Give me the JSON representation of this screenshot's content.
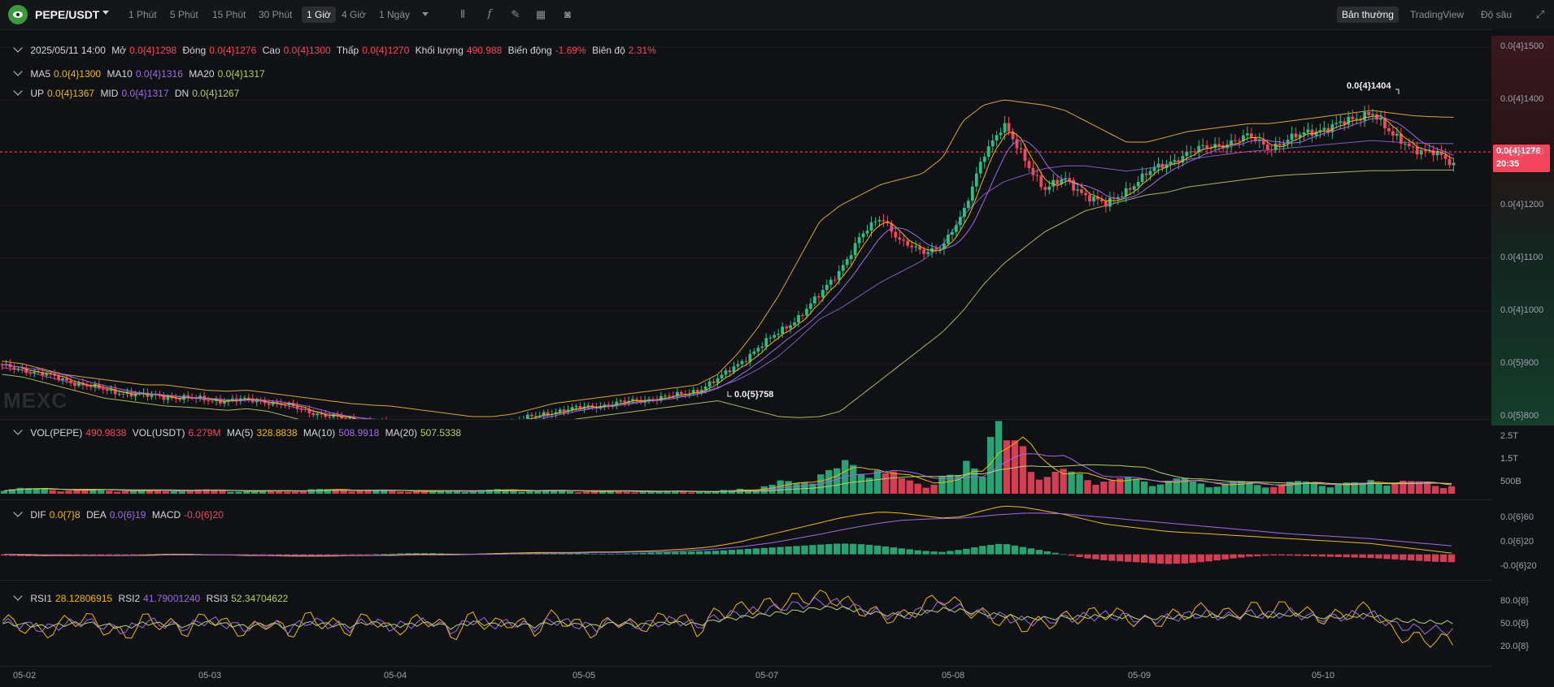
{
  "toolbar": {
    "symbol": "PEPE/USDT",
    "timeframes": [
      "1 Phút",
      "5 Phút",
      "15 Phút",
      "30 Phút",
      "1 Giờ",
      "4 Giờ",
      "1 Ngày"
    ],
    "active_timeframe": "1 Giờ",
    "modes": [
      "Bản thường",
      "TradingView",
      "Độ sâu"
    ],
    "active_mode": "Bản thường"
  },
  "ohlc": {
    "date": "2025/05/11 14:00",
    "open_label": "Mở",
    "open": "0.0{4}1298",
    "close_label": "Đóng",
    "close": "0.0{4}1276",
    "high_label": "Cao",
    "high": "0.0{4}1300",
    "low_label": "Thấp",
    "low": "0.0{4}1270",
    "volume_label": "Khối lượng",
    "volume": "490.988",
    "change_label": "Biến động",
    "change": "-1.69%",
    "amplitude_label": "Biên độ",
    "amplitude": "2.31%"
  },
  "ma": {
    "ma5_label": "MA5",
    "ma5": "0.0{4}1300",
    "ma10_label": "MA10",
    "ma10": "0.0{4}1316",
    "ma20_label": "MA20",
    "ma20": "0.0{4}1317"
  },
  "boll": {
    "up_label": "UP",
    "up": "0.0{4}1367",
    "mid_label": "MID",
    "mid": "0.0{4}1317",
    "dn_label": "DN",
    "dn": "0.0{4}1267"
  },
  "vol": {
    "pepe_label": "VOL(PEPE)",
    "pepe": "490.9838",
    "usdt_label": "VOL(USDT)",
    "usdt": "6.279M",
    "ma5_label": "MA(5)",
    "ma5": "328.8838",
    "ma10_label": "MA(10)",
    "ma10": "508.9918",
    "ma20_label": "MA(20)",
    "ma20": "507.5338"
  },
  "macd": {
    "dif_label": "DIF",
    "dif": "0.0{7}8",
    "dea_label": "DEA",
    "dea": "0.0{6}19",
    "macd_label": "MACD",
    "macd": "-0.0{6}20"
  },
  "rsi": {
    "rsi1_label": "RSI1",
    "rsi1": "28.12806915",
    "rsi2_label": "RSI2",
    "rsi2": "41.79001240",
    "rsi3_label": "RSI3",
    "rsi3": "52.34704622"
  },
  "last_price": {
    "value": "0.0{4}1276",
    "countdown": "20:35"
  },
  "annotations": {
    "high": "0.0{4}1404",
    "low": "0.0{5}758"
  },
  "watermark": "MEXC",
  "colors": {
    "up": "#2ebd85",
    "down": "#f6465d",
    "ma5": "#f0b90b",
    "ma10": "#a06ae8",
    "ma20": "#b5d06a"
  },
  "chart_data": [
    {
      "type": "candlestick",
      "price_axis_ticks": [
        "0.0{4}1500",
        "0.0{4}1400",
        "0.0{4}1300",
        "0.0{4}1200",
        "0.0{4}1100",
        "0.0{4}1000",
        "0.0{5}900",
        "0.0{5}800"
      ],
      "price_axis_values": [
        1.5e-05,
        1.4e-05,
        1.3e-05,
        1.2e-05,
        1.1e-05,
        1e-05,
        9e-06,
        8e-06
      ],
      "x_ticks": [
        "05-02",
        "05-03",
        "05-04",
        "05-05",
        "05-07",
        "05-08",
        "05-09",
        "05-10"
      ],
      "close_path": [
        8.95e-06,
        8.9e-06,
        8.8e-06,
        8.7e-06,
        8.6e-06,
        8.5e-06,
        8.45e-06,
        8.4e-06,
        8.38e-06,
        8.35e-06,
        8.32e-06,
        8.3e-06,
        8.32e-06,
        8.28e-06,
        8.2e-06,
        8.1e-06,
        8e-06,
        7.95e-06,
        7.9e-06,
        7.85e-06,
        7.8e-06,
        7.75e-06,
        7.7e-06,
        7.65e-06,
        7.75e-06,
        7.9e-06,
        8e-06,
        8.1e-06,
        8.15e-06,
        8.2e-06,
        8.25e-06,
        8.3e-06,
        8.35e-06,
        8.4e-06,
        8.5e-06,
        8.7e-06,
        9e-06,
        9.3e-06,
        9.6e-06,
        9.9e-06,
        1.03e-05,
        1.08e-05,
        1.14e-05,
        1.18e-05,
        1.13e-05,
        1.11e-05,
        1.125e-05,
        1.18e-05,
        1.3e-05,
        1.35e-05,
        1.29e-05,
        1.23e-05,
        1.25e-05,
        1.22e-05,
        1.2e-05,
        1.23e-05,
        1.26e-05,
        1.28e-05,
        1.3e-05,
        1.31e-05,
        1.32e-05,
        1.33e-05,
        1.31e-05,
        1.325e-05,
        1.34e-05,
        1.35e-05,
        1.36e-05,
        1.38e-05,
        1.33e-05,
        1.31e-05,
        1.3e-05,
        1.276e-05
      ],
      "ma_upper_band": [
        9.05e-06,
        9e-06,
        8.9e-06,
        8.8e-06,
        8.75e-06,
        8.7e-06,
        8.65e-06,
        8.6e-06,
        8.6e-06,
        8.55e-06,
        8.5e-06,
        8.48e-06,
        8.5e-06,
        8.45e-06,
        8.4e-06,
        8.35e-06,
        8.3e-06,
        8.25e-06,
        8.22e-06,
        8.2e-06,
        8.15e-06,
        8.1e-06,
        8.05e-06,
        8e-06,
        8e-06,
        8.05e-06,
        8.15e-06,
        8.25e-06,
        8.3e-06,
        8.35e-06,
        8.4e-06,
        8.45e-06,
        8.5e-06,
        8.55e-06,
        8.6e-06,
        8.8e-06,
        9.2e-06,
        9.7e-06,
        1.03e-05,
        1.1e-05,
        1.17e-05,
        1.2e-05,
        1.22e-05,
        1.24e-05,
        1.25e-05,
        1.26e-05,
        1.29e-05,
        1.36e-05,
        1.39e-05,
        1.4e-05,
        1.395e-05,
        1.39e-05,
        1.38e-05,
        1.36e-05,
        1.34e-05,
        1.32e-05,
        1.32e-05,
        1.33e-05,
        1.34e-05,
        1.345e-05,
        1.35e-05,
        1.355e-05,
        1.355e-05,
        1.36e-05,
        1.365e-05,
        1.37e-05,
        1.375e-05,
        1.38e-05,
        1.375e-05,
        1.37e-05,
        1.368e-05,
        1.367e-05
      ],
      "ma_lower_band": [
        8.8e-06,
        8.75e-06,
        8.65e-06,
        8.55e-06,
        8.45e-06,
        8.35e-06,
        8.3e-06,
        8.25e-06,
        8.2e-06,
        8.18e-06,
        8.15e-06,
        8.12e-06,
        8.15e-06,
        8.1e-06,
        8e-06,
        7.9e-06,
        7.8e-06,
        7.75e-06,
        7.7e-06,
        7.65e-06,
        7.6e-06,
        7.57e-06,
        7.55e-06,
        7.52e-06,
        7.55e-06,
        7.65e-06,
        7.75e-06,
        7.85e-06,
        7.95e-06,
        8e-06,
        8.05e-06,
        8.1e-06,
        8.15e-06,
        8.2e-06,
        8.25e-06,
        8.3e-06,
        8.2e-06,
        8.1e-06,
        8e-06,
        7.98e-06,
        8e-06,
        8.1e-06,
        8.4e-06,
        8.7e-06,
        9e-06,
        9.3e-06,
        9.6e-06,
        1e-05,
        1.05e-05,
        1.09e-05,
        1.12e-05,
        1.15e-05,
        1.17e-05,
        1.19e-05,
        1.2e-05,
        1.21e-05,
        1.22e-05,
        1.225e-05,
        1.235e-05,
        1.24e-05,
        1.245e-05,
        1.25e-05,
        1.255e-05,
        1.258e-05,
        1.26e-05,
        1.262e-05,
        1.264e-05,
        1.266e-05,
        1.266e-05,
        1.267e-05,
        1.267e-05,
        1.267e-05
      ]
    },
    {
      "type": "bar",
      "name": "VOL",
      "y_ticks": [
        "2.5T",
        "1.5T",
        "500B"
      ],
      "y_tick_values": [
        2500,
        1500,
        500
      ],
      "values": [
        210,
        180,
        160,
        150,
        140,
        130,
        120,
        110,
        150,
        140,
        120,
        110,
        100,
        120,
        130,
        150,
        160,
        140,
        120,
        110,
        100,
        90,
        110,
        130,
        150,
        140,
        120,
        110,
        100,
        90,
        80,
        100,
        90,
        80,
        90,
        120,
        200,
        300,
        420,
        600,
        800,
        1100,
        1000,
        700,
        500,
        400,
        600,
        1200,
        2600,
        1700,
        1000,
        800,
        700,
        600,
        500,
        520,
        480,
        500,
        420,
        380,
        400,
        350,
        380,
        400,
        420,
        380,
        360,
        520,
        450,
        400,
        380,
        330
      ],
      "directions": [
        "up",
        "up",
        "down",
        "down",
        "up",
        "down",
        "up",
        "down",
        "up",
        "down",
        "down",
        "up",
        "up",
        "down",
        "down",
        "up",
        "down",
        "down",
        "up",
        "down",
        "down",
        "up",
        "up",
        "up",
        "up",
        "up",
        "up",
        "up",
        "down",
        "up",
        "down",
        "up",
        "up",
        "down",
        "up",
        "up",
        "up",
        "up",
        "up",
        "up",
        "up",
        "up",
        "up",
        "down",
        "down",
        "down",
        "up",
        "up",
        "up",
        "down",
        "down",
        "down",
        "up",
        "down",
        "down",
        "up",
        "up",
        "up",
        "up",
        "up",
        "up",
        "up",
        "down",
        "up",
        "up",
        "up",
        "up",
        "up",
        "down",
        "down",
        "down",
        "down"
      ]
    },
    {
      "type": "bar",
      "name": "MACD",
      "y_ticks": [
        "0.0{6}60",
        "0.0{6}20",
        "-0.0{6}20"
      ],
      "y_tick_values": [
        60,
        20,
        -20
      ],
      "histogram": [
        -2,
        -3,
        -3,
        -2,
        -2,
        -1,
        -1,
        0,
        1,
        1,
        0,
        -1,
        -2,
        -2,
        -3,
        -2,
        -1,
        -1,
        0,
        1,
        2,
        2,
        1,
        1,
        2,
        3,
        3,
        2,
        2,
        1,
        1,
        2,
        3,
        4,
        5,
        6,
        8,
        10,
        12,
        14,
        16,
        18,
        17,
        14,
        10,
        6,
        4,
        8,
        14,
        18,
        12,
        6,
        0,
        -6,
        -10,
        -12,
        -14,
        -16,
        -15,
        -12,
        -8,
        -4,
        -2,
        -2,
        -3,
        -4,
        -5,
        -6,
        -8,
        -10,
        -12,
        -13
      ],
      "dif": [
        0,
        -1,
        -2,
        -2,
        -2,
        -2,
        -2,
        -1,
        0,
        0,
        -1,
        -1,
        -2,
        -2,
        -3,
        -3,
        -3,
        -2,
        -2,
        -1,
        0,
        0,
        0,
        0,
        1,
        2,
        3,
        3,
        3,
        4,
        4,
        5,
        6,
        8,
        10,
        14,
        20,
        28,
        36,
        44,
        52,
        60,
        66,
        70,
        68,
        64,
        60,
        62,
        72,
        80,
        78,
        72,
        66,
        58,
        50,
        46,
        42,
        38,
        36,
        34,
        32,
        30,
        28,
        26,
        24,
        22,
        20,
        18,
        14,
        10,
        6,
        2
      ],
      "dea": [
        0,
        0,
        -1,
        -1,
        -2,
        -2,
        -2,
        -2,
        -1,
        -1,
        -1,
        -1,
        -1,
        -2,
        -2,
        -2,
        -2,
        -2,
        -2,
        -2,
        -1,
        -1,
        -1,
        0,
        0,
        1,
        1,
        2,
        2,
        3,
        3,
        4,
        4,
        5,
        7,
        9,
        12,
        16,
        21,
        27,
        33,
        40,
        46,
        52,
        56,
        58,
        59,
        60,
        63,
        66,
        68,
        68,
        67,
        64,
        61,
        58,
        55,
        52,
        49,
        46,
        43,
        40,
        37,
        34,
        32,
        30,
        28,
        26,
        23,
        20,
        17,
        14
      ]
    },
    {
      "type": "line",
      "name": "RSI",
      "y_ticks": [
        "80.0{8}",
        "50.0{8}",
        "20.0{8}"
      ],
      "y_tick_values": [
        80,
        50,
        20
      ],
      "series": [
        {
          "name": "RSI1",
          "values": [
            55,
            48,
            38,
            52,
            60,
            45,
            35,
            58,
            50,
            42,
            62,
            48,
            40,
            55,
            38,
            60,
            50,
            44,
            62,
            40,
            52,
            58,
            35,
            60,
            48,
            55,
            42,
            62,
            50,
            40,
            58,
            45,
            55,
            62,
            42,
            66,
            70,
            74,
            78,
            84,
            88,
            82,
            70,
            62,
            58,
            74,
            86,
            72,
            62,
            56,
            48,
            52,
            58,
            62,
            66,
            60,
            52,
            58,
            66,
            70,
            62,
            72,
            68,
            74,
            62,
            58,
            66,
            72,
            40,
            32,
            30,
            28
          ]
        },
        {
          "name": "RSI2",
          "values": [
            52,
            50,
            44,
            50,
            54,
            48,
            42,
            54,
            50,
            46,
            56,
            50,
            45,
            52,
            44,
            55,
            50,
            46,
            56,
            46,
            51,
            54,
            42,
            56,
            50,
            52,
            46,
            56,
            50,
            46,
            54,
            48,
            52,
            56,
            48,
            60,
            64,
            68,
            72,
            76,
            80,
            78,
            70,
            64,
            60,
            68,
            76,
            70,
            64,
            60,
            54,
            55,
            58,
            60,
            62,
            60,
            56,
            58,
            62,
            64,
            60,
            64,
            62,
            66,
            60,
            58,
            62,
            64,
            50,
            45,
            43,
            42
          ]
        },
        {
          "name": "RSI3",
          "values": [
            51,
            50,
            47,
            50,
            52,
            49,
            46,
            52,
            50,
            48,
            53,
            50,
            47,
            51,
            47,
            52,
            50,
            48,
            53,
            48,
            50,
            52,
            46,
            53,
            50,
            51,
            48,
            53,
            50,
            48,
            52,
            49,
            51,
            53,
            50,
            56,
            59,
            62,
            65,
            68,
            72,
            72,
            68,
            64,
            62,
            65,
            70,
            68,
            64,
            62,
            58,
            58,
            59,
            60,
            61,
            60,
            58,
            59,
            61,
            62,
            60,
            62,
            61,
            63,
            60,
            59,
            61,
            62,
            56,
            54,
            53,
            52
          ]
        }
      ]
    }
  ]
}
